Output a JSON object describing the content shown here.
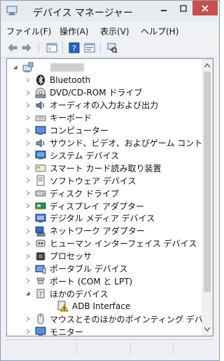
{
  "window": {
    "title": "デバイス マネージャー"
  },
  "menu": [
    {
      "label": "ファイル(F)"
    },
    {
      "label": "操作(A)"
    },
    {
      "label": "表示(V)"
    },
    {
      "label": "ヘルプ(H)"
    }
  ],
  "toolbar": [
    {
      "name": "back-icon"
    },
    {
      "name": "forward-icon"
    },
    {
      "name": "show-hide-console-tree-icon"
    },
    {
      "name": "help-icon"
    },
    {
      "name": "properties-icon"
    },
    {
      "name": "scan-hardware-icon"
    }
  ],
  "tree": {
    "root": {
      "label": "",
      "icon": "computer-icon",
      "expanded": true
    },
    "items": [
      {
        "label": "Bluetooth",
        "icon": "bluetooth-icon"
      },
      {
        "label": "DVD/CD-ROM ドライブ",
        "icon": "dvd-drive-icon"
      },
      {
        "label": "オーディオの入力および出力",
        "icon": "speaker-icon"
      },
      {
        "label": "キーボード",
        "icon": "keyboard-icon"
      },
      {
        "label": "コンピューター",
        "icon": "monitor-icon"
      },
      {
        "label": "サウンド、ビデオ、およびゲーム コントローラー",
        "icon": "sound-icon"
      },
      {
        "label": "システム デバイス",
        "icon": "system-devices-icon"
      },
      {
        "label": "スマート カード読み取り装置",
        "icon": "smart-card-icon"
      },
      {
        "label": "ソフトウェア デバイス",
        "icon": "software-device-icon"
      },
      {
        "label": "ディスク ドライブ",
        "icon": "disk-drive-icon"
      },
      {
        "label": "ディスプレイ アダプター",
        "icon": "display-adapter-icon"
      },
      {
        "label": "デジタル メディア デバイス",
        "icon": "media-device-icon"
      },
      {
        "label": "ネットワーク アダプター",
        "icon": "network-adapter-icon"
      },
      {
        "label": "ヒューマン インターフェイス デバイス",
        "icon": "hid-icon"
      },
      {
        "label": "プロセッサ",
        "icon": "processor-icon"
      },
      {
        "label": "ポータブル デバイス",
        "icon": "portable-device-icon"
      },
      {
        "label": "ポート (COM と LPT)",
        "icon": "port-icon"
      },
      {
        "label": "ほかのデバイス",
        "icon": "other-devices-icon",
        "expanded": true
      },
      {
        "label": "ADB Interface",
        "icon": "warning-device-icon",
        "child": true
      },
      {
        "label": "マウスとそのほかのポインティング デバイス",
        "icon": "mouse-icon"
      },
      {
        "label": "モニター",
        "icon": "monitor-icon"
      }
    ]
  },
  "colors": {
    "close_button": "#c7504c",
    "warning": "#f2c200",
    "accent": "#1f5fbf"
  }
}
